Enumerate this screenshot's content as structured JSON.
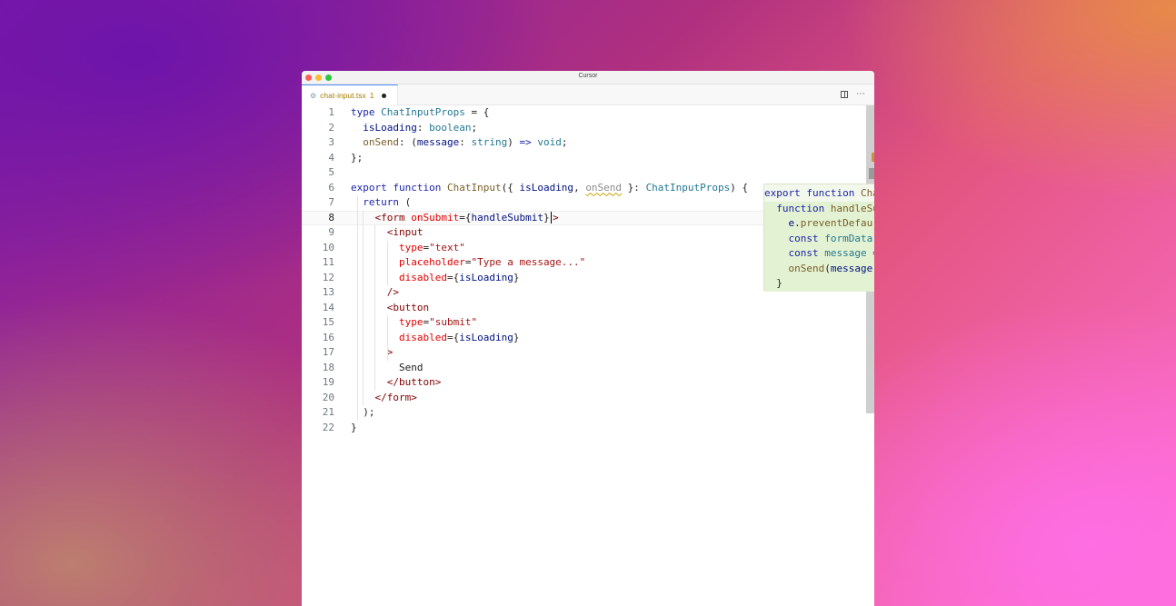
{
  "window": {
    "title": "Cursor"
  },
  "tab": {
    "filename": "chat-input.tsx",
    "problems": "1"
  },
  "code_lines": [
    {
      "n": "1",
      "segs": [
        [
          "kw",
          "type "
        ],
        [
          "ty",
          "ChatInputProps"
        ],
        [
          "plain",
          " = {"
        ]
      ]
    },
    {
      "n": "2",
      "segs": [
        [
          "plain",
          "  "
        ],
        [
          "param",
          "isLoading"
        ],
        [
          "plain",
          ": "
        ],
        [
          "ty",
          "boolean"
        ],
        [
          "plain",
          ";"
        ]
      ]
    },
    {
      "n": "3",
      "segs": [
        [
          "plain",
          "  "
        ],
        [
          "fn",
          "onSend"
        ],
        [
          "plain",
          ": ("
        ],
        [
          "param",
          "message"
        ],
        [
          "plain",
          ": "
        ],
        [
          "ty",
          "string"
        ],
        [
          "plain",
          ") "
        ],
        [
          "kw",
          "=>"
        ],
        [
          "plain",
          " "
        ],
        [
          "ty",
          "void"
        ],
        [
          "plain",
          ";"
        ]
      ]
    },
    {
      "n": "4",
      "segs": [
        [
          "plain",
          "};"
        ]
      ]
    },
    {
      "n": "5",
      "segs": []
    },
    {
      "n": "6",
      "segs": [
        [
          "kw",
          "export function "
        ],
        [
          "fn",
          "ChatInput"
        ],
        [
          "plain",
          "({ "
        ],
        [
          "param",
          "isLoading"
        ],
        [
          "plain",
          ", "
        ],
        [
          "squig",
          "onSend"
        ],
        [
          "plain",
          " }: "
        ],
        [
          "ty",
          "ChatInputProps"
        ],
        [
          "plain",
          ") {"
        ]
      ]
    },
    {
      "n": "7",
      "segs": [
        [
          "plain",
          "  "
        ],
        [
          "kw",
          "return"
        ],
        [
          "plain",
          " ("
        ]
      ]
    },
    {
      "n": "8",
      "segs": [
        [
          "plain",
          "    "
        ],
        [
          "tag",
          "<form"
        ],
        [
          "plain",
          " "
        ],
        [
          "attr",
          "onSubmit"
        ],
        [
          "plain",
          "={"
        ],
        [
          "param",
          "handleSubmit"
        ],
        [
          "plain",
          "}"
        ],
        [
          "cursor",
          ""
        ],
        [
          "tag",
          ">"
        ]
      ]
    },
    {
      "n": "9",
      "segs": [
        [
          "plain",
          "      "
        ],
        [
          "tag",
          "<input"
        ]
      ]
    },
    {
      "n": "10",
      "segs": [
        [
          "plain",
          "        "
        ],
        [
          "attr",
          "type"
        ],
        [
          "plain",
          "="
        ],
        [
          "str",
          "\"text\""
        ]
      ]
    },
    {
      "n": "11",
      "segs": [
        [
          "plain",
          "        "
        ],
        [
          "attr",
          "placeholder"
        ],
        [
          "plain",
          "="
        ],
        [
          "str",
          "\"Type a message...\""
        ]
      ]
    },
    {
      "n": "12",
      "segs": [
        [
          "plain",
          "        "
        ],
        [
          "attr",
          "disabled"
        ],
        [
          "plain",
          "={"
        ],
        [
          "param",
          "isLoading"
        ],
        [
          "plain",
          "}"
        ]
      ]
    },
    {
      "n": "13",
      "segs": [
        [
          "plain",
          "      "
        ],
        [
          "tag",
          "/>"
        ]
      ]
    },
    {
      "n": "14",
      "segs": [
        [
          "plain",
          "      "
        ],
        [
          "tag",
          "<button"
        ]
      ]
    },
    {
      "n": "15",
      "segs": [
        [
          "plain",
          "        "
        ],
        [
          "attr",
          "type"
        ],
        [
          "plain",
          "="
        ],
        [
          "str",
          "\"submit\""
        ]
      ]
    },
    {
      "n": "16",
      "segs": [
        [
          "plain",
          "        "
        ],
        [
          "attr",
          "disabled"
        ],
        [
          "plain",
          "={"
        ],
        [
          "param",
          "isLoading"
        ],
        [
          "plain",
          "}"
        ]
      ]
    },
    {
      "n": "17",
      "segs": [
        [
          "plain",
          "      "
        ],
        [
          "tag",
          ">"
        ]
      ]
    },
    {
      "n": "18",
      "segs": [
        [
          "plain",
          "        Send"
        ]
      ]
    },
    {
      "n": "19",
      "segs": [
        [
          "plain",
          "      "
        ],
        [
          "tag",
          "</button>"
        ]
      ]
    },
    {
      "n": "20",
      "segs": [
        [
          "plain",
          "    "
        ],
        [
          "tag",
          "</form>"
        ]
      ]
    },
    {
      "n": "21",
      "segs": [
        [
          "plain",
          "  );"
        ]
      ]
    },
    {
      "n": "22",
      "segs": [
        [
          "plain",
          "}"
        ]
      ]
    }
  ],
  "active_line": "8",
  "suggestion_lines": [
    {
      "segs": [
        [
          "kw",
          "export function "
        ],
        [
          "fn",
          "Cha"
        ]
      ]
    },
    {
      "segs": [
        [
          "plain",
          "  "
        ],
        [
          "kw",
          "function "
        ],
        [
          "fn",
          "handleSu"
        ]
      ]
    },
    {
      "segs": [
        [
          "plain",
          "    "
        ],
        [
          "param",
          "e"
        ],
        [
          "plain",
          "."
        ],
        [
          "fn",
          "preventDefau"
        ]
      ]
    },
    {
      "segs": [
        [
          "plain",
          "    "
        ],
        [
          "kw",
          "const "
        ],
        [
          "ty",
          "formData"
        ]
      ]
    },
    {
      "segs": [
        [
          "plain",
          "    "
        ],
        [
          "kw",
          "const "
        ],
        [
          "ty",
          "message"
        ],
        [
          "plain",
          " ="
        ]
      ]
    },
    {
      "segs": [
        [
          "plain",
          "    "
        ],
        [
          "fn",
          "onSend"
        ],
        [
          "plain",
          "("
        ],
        [
          "param",
          "message"
        ]
      ]
    },
    {
      "segs": [
        [
          "plain",
          "  "
        ],
        [
          "plain",
          "}"
        ]
      ]
    }
  ],
  "icons": [
    "settings-file-icon",
    "split-editor-icon",
    "more-actions-icon"
  ]
}
